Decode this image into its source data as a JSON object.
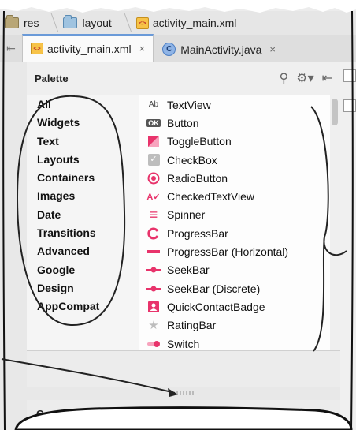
{
  "breadcrumb": {
    "items": [
      {
        "label": "res",
        "icon": "folder-icon"
      },
      {
        "label": "layout",
        "icon": "folder-icon"
      },
      {
        "label": "activity_main.xml",
        "icon": "xml-file-icon"
      }
    ]
  },
  "tabs": [
    {
      "label": "activity_main.xml",
      "icon": "xml-file-icon",
      "active": true,
      "close": "×"
    },
    {
      "label": "MainActivity.java",
      "icon": "class-c-icon",
      "active": false,
      "close": "×"
    }
  ],
  "palette": {
    "title": "Palette",
    "categories": [
      "All",
      "Widgets",
      "Text",
      "Layouts",
      "Containers",
      "Images",
      "Date",
      "Transitions",
      "Advanced",
      "Google",
      "Design",
      "AppCompat"
    ],
    "widgets": [
      {
        "label": "TextView",
        "icon": "textview-icon",
        "glyph": "Ab"
      },
      {
        "label": "Button",
        "icon": "button-icon",
        "glyph": "OK"
      },
      {
        "label": "ToggleButton",
        "icon": "togglebutton-icon",
        "glyph": ""
      },
      {
        "label": "CheckBox",
        "icon": "checkbox-icon",
        "glyph": "✓"
      },
      {
        "label": "RadioButton",
        "icon": "radiobutton-icon",
        "glyph": ""
      },
      {
        "label": "CheckedTextView",
        "icon": "checkedtextview-icon",
        "glyph": "A✓"
      },
      {
        "label": "Spinner",
        "icon": "spinner-icon",
        "glyph": "≡"
      },
      {
        "label": "ProgressBar",
        "icon": "progressbar-icon",
        "glyph": ""
      },
      {
        "label": "ProgressBar (Horizontal)",
        "icon": "progressbar-horizontal-icon",
        "glyph": ""
      },
      {
        "label": "SeekBar",
        "icon": "seekbar-icon",
        "glyph": ""
      },
      {
        "label": "SeekBar (Discrete)",
        "icon": "seekbar-discrete-icon",
        "glyph": ""
      },
      {
        "label": "QuickContactBadge",
        "icon": "quickcontactbadge-icon",
        "glyph": ""
      },
      {
        "label": "RatingBar",
        "icon": "ratingbar-icon",
        "glyph": "★"
      },
      {
        "label": "Switch",
        "icon": "switch-icon",
        "glyph": ""
      }
    ]
  },
  "component_tree": {
    "title": "Component Tree"
  },
  "colors": {
    "accent": "#e8336b",
    "tab_active_border": "#6a9ad8"
  }
}
